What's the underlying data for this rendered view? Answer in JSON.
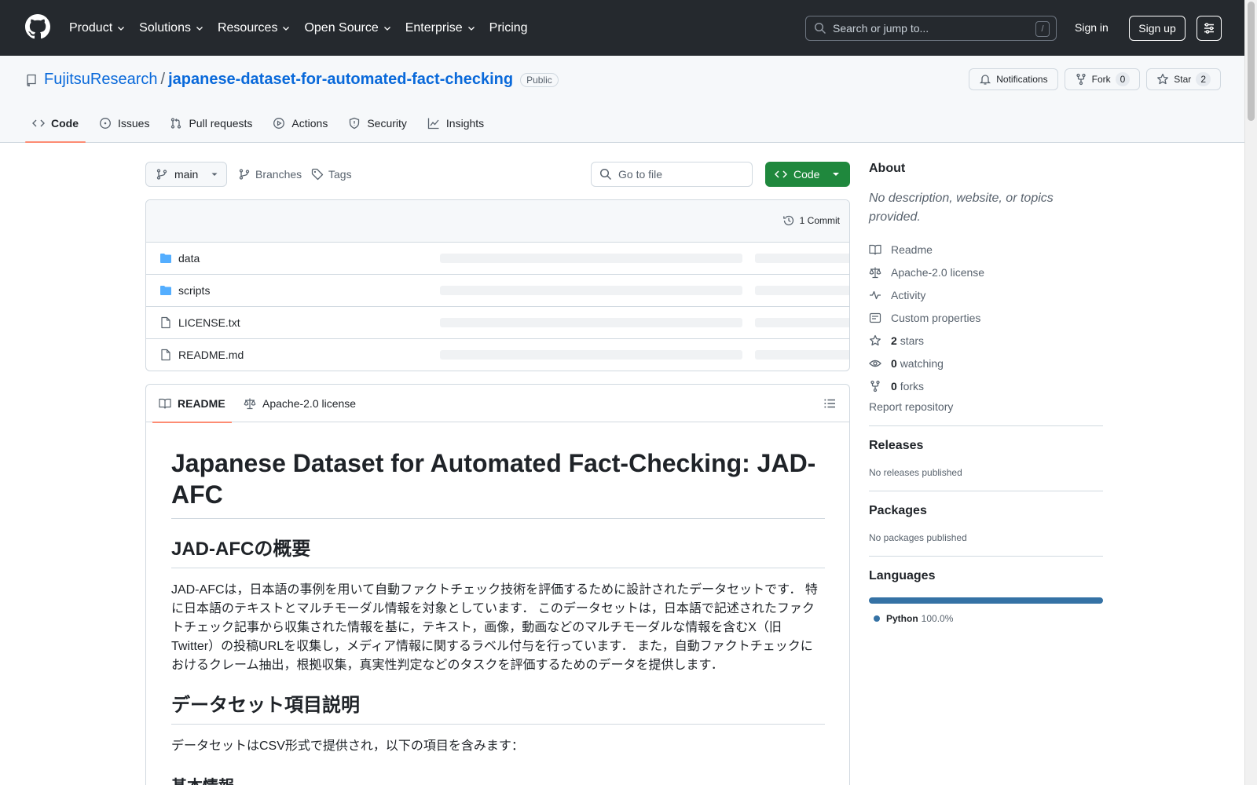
{
  "header": {
    "nav": [
      "Product",
      "Solutions",
      "Resources",
      "Open Source",
      "Enterprise",
      "Pricing"
    ],
    "search_placeholder": "Search or jump to...",
    "search_key": "/",
    "sign_in": "Sign in",
    "sign_up": "Sign up"
  },
  "repo": {
    "owner": "FujitsuResearch",
    "separator": "/",
    "name": "japanese-dataset-for-automated-fact-checking",
    "visibility": "Public",
    "notifications_label": "Notifications",
    "fork_label": "Fork",
    "fork_count": "0",
    "star_label": "Star",
    "star_count": "2",
    "tabs": [
      "Code",
      "Issues",
      "Pull requests",
      "Actions",
      "Security",
      "Insights"
    ]
  },
  "toolbar": {
    "branch": "main",
    "branches_label": "Branches",
    "tags_label": "Tags",
    "goto_placeholder": "Go to file",
    "code_button": "Code"
  },
  "files": {
    "commits_label": "1 Commit",
    "items": [
      {
        "name": "data",
        "type": "folder"
      },
      {
        "name": "scripts",
        "type": "folder"
      },
      {
        "name": "LICENSE.txt",
        "type": "file"
      },
      {
        "name": "README.md",
        "type": "file"
      }
    ]
  },
  "readme": {
    "tab_readme": "README",
    "tab_license": "Apache-2.0 license",
    "h1": "Japanese Dataset for Automated Fact-Checking: JAD-AFC",
    "h2_overview": "JAD-AFCの概要",
    "p_overview": "JAD-AFCは，日本語の事例を用いて自動ファクトチェック技術を評価するために設計されたデータセットです． 特に日本語のテキストとマルチモーダル情報を対象としています． このデータセットは，日本語で記述されたファクトチェック記事から収集された情報を基に，テキスト，画像，動画などのマルチモーダルな情報を含むX（旧Twitter）の投稿URLを収集し，メディア情報に関するラベル付与を行っています． また，自動ファクトチェックにおけるクレーム抽出，根拠収集，真実性判定などのタスクを評価するためのデータを提供します．",
    "h2_items": "データセット項目説明",
    "p_items": "データセットはCSV形式で提供され，以下の項目を含みます：",
    "h3_basic": "基本情報"
  },
  "sidebar": {
    "about_title": "About",
    "about_desc": "No description, website, or topics provided.",
    "readme": "Readme",
    "license": "Apache-2.0 license",
    "activity": "Activity",
    "custom_properties": "Custom properties",
    "stars_count": "2",
    "stars_label": "stars",
    "watching_count": "0",
    "watching_label": "watching",
    "forks_count": "0",
    "forks_label": "forks",
    "report": "Report repository",
    "releases_title": "Releases",
    "releases_empty": "No releases published",
    "packages_title": "Packages",
    "packages_empty": "No packages published",
    "languages_title": "Languages",
    "language_name": "Python",
    "language_pct": "100.0%",
    "language_fraction": 1.0
  },
  "colors": {
    "header_bg": "#25292e",
    "link": "#0969da",
    "primary_green": "#1f883d",
    "tab_underline": "#fd8c73",
    "python": "#3572A5"
  }
}
